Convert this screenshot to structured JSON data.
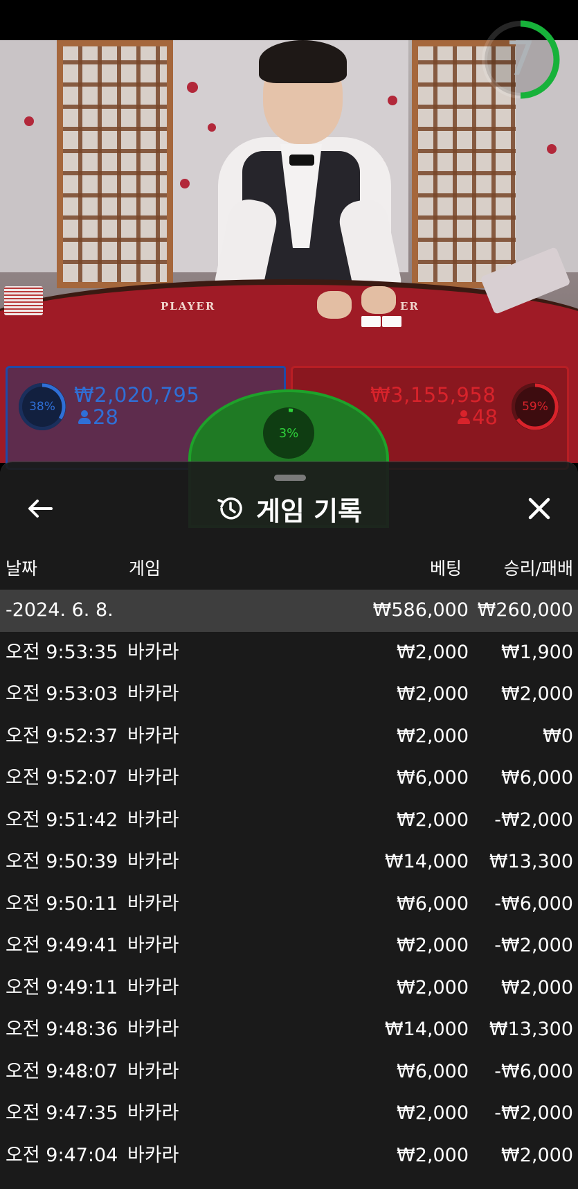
{
  "timer": {
    "countdown": "7"
  },
  "scene": {
    "felt_left": "PLAYER",
    "felt_right": "ER"
  },
  "bets": {
    "player": {
      "percent": "38%",
      "amount": "₩2,020,795",
      "players": "28",
      "color": "#2f6fd6"
    },
    "tie": {
      "percent": "3%",
      "color": "#2ed13a"
    },
    "banker": {
      "percent": "59%",
      "amount": "₩3,155,958",
      "players": "48",
      "color": "#d8232b"
    }
  },
  "history": {
    "title": "게임 기록",
    "icons": {
      "back": "arrow-left-icon",
      "title": "history-clock-icon",
      "close": "close-icon"
    },
    "columns": {
      "date": "날짜",
      "game": "게임",
      "bet": "베팅",
      "result": "승리/패배"
    },
    "date_row": {
      "date": "-2024. 6. 8.",
      "bet": "₩586,000",
      "result": "₩260,000"
    },
    "rows": [
      {
        "time": "오전 9:53:35",
        "game": "바카라",
        "bet": "₩2,000",
        "result": "₩1,900"
      },
      {
        "time": "오전 9:53:03",
        "game": "바카라",
        "bet": "₩2,000",
        "result": "₩2,000"
      },
      {
        "time": "오전 9:52:37",
        "game": "바카라",
        "bet": "₩2,000",
        "result": "₩0"
      },
      {
        "time": "오전 9:52:07",
        "game": "바카라",
        "bet": "₩6,000",
        "result": "₩6,000"
      },
      {
        "time": "오전 9:51:42",
        "game": "바카라",
        "bet": "₩2,000",
        "result": "-₩2,000"
      },
      {
        "time": "오전 9:50:39",
        "game": "바카라",
        "bet": "₩14,000",
        "result": "₩13,300"
      },
      {
        "time": "오전 9:50:11",
        "game": "바카라",
        "bet": "₩6,000",
        "result": "-₩6,000"
      },
      {
        "time": "오전 9:49:41",
        "game": "바카라",
        "bet": "₩2,000",
        "result": "-₩2,000"
      },
      {
        "time": "오전 9:49:11",
        "game": "바카라",
        "bet": "₩2,000",
        "result": "₩2,000"
      },
      {
        "time": "오전 9:48:36",
        "game": "바카라",
        "bet": "₩14,000",
        "result": "₩13,300"
      },
      {
        "time": "오전 9:48:07",
        "game": "바카라",
        "bet": "₩6,000",
        "result": "-₩6,000"
      },
      {
        "time": "오전 9:47:35",
        "game": "바카라",
        "bet": "₩2,000",
        "result": "-₩2,000"
      },
      {
        "time": "오전 9:47:04",
        "game": "바카라",
        "bet": "₩2,000",
        "result": "₩2,000"
      }
    ]
  }
}
